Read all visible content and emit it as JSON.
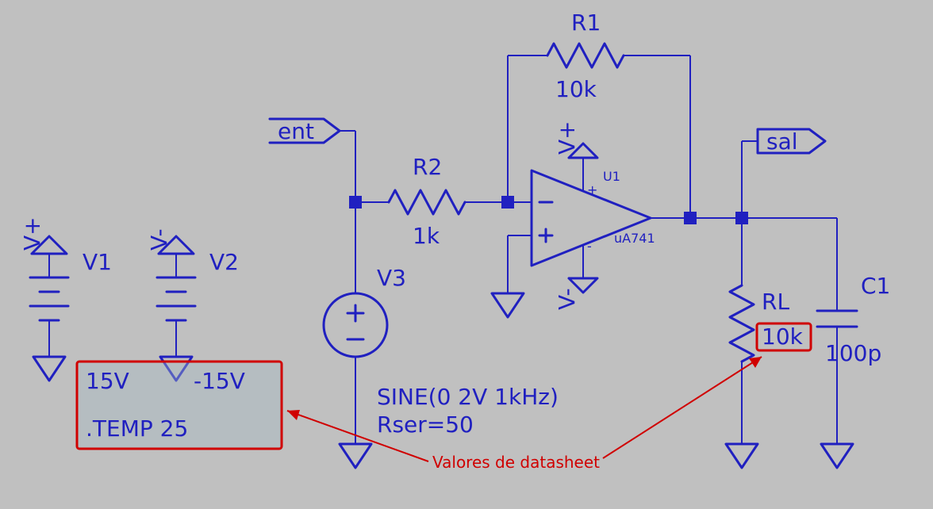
{
  "components": {
    "v1": {
      "ref": "V1",
      "value": "15V",
      "netlabel": "V+"
    },
    "v2": {
      "ref": "V2",
      "value": "-15V",
      "netlabel": "V-"
    },
    "v3": {
      "ref": "V3",
      "params_line1": "SINE(0 2V 1kHz)",
      "params_line2": "Rser=50"
    },
    "r1": {
      "ref": "R1",
      "value": "10k"
    },
    "r2": {
      "ref": "R2",
      "value": "1k"
    },
    "rl": {
      "ref": "RL",
      "value": "10k"
    },
    "c1": {
      "ref": "C1",
      "value": "100p"
    },
    "u1": {
      "ref": "U1",
      "model": "uA741",
      "vplus": "V+",
      "vminus": "V-"
    },
    "netlabels": {
      "ent": "ent",
      "sal": "sal"
    },
    "directive": ".TEMP 25",
    "annotation": "Valores de datasheet"
  }
}
